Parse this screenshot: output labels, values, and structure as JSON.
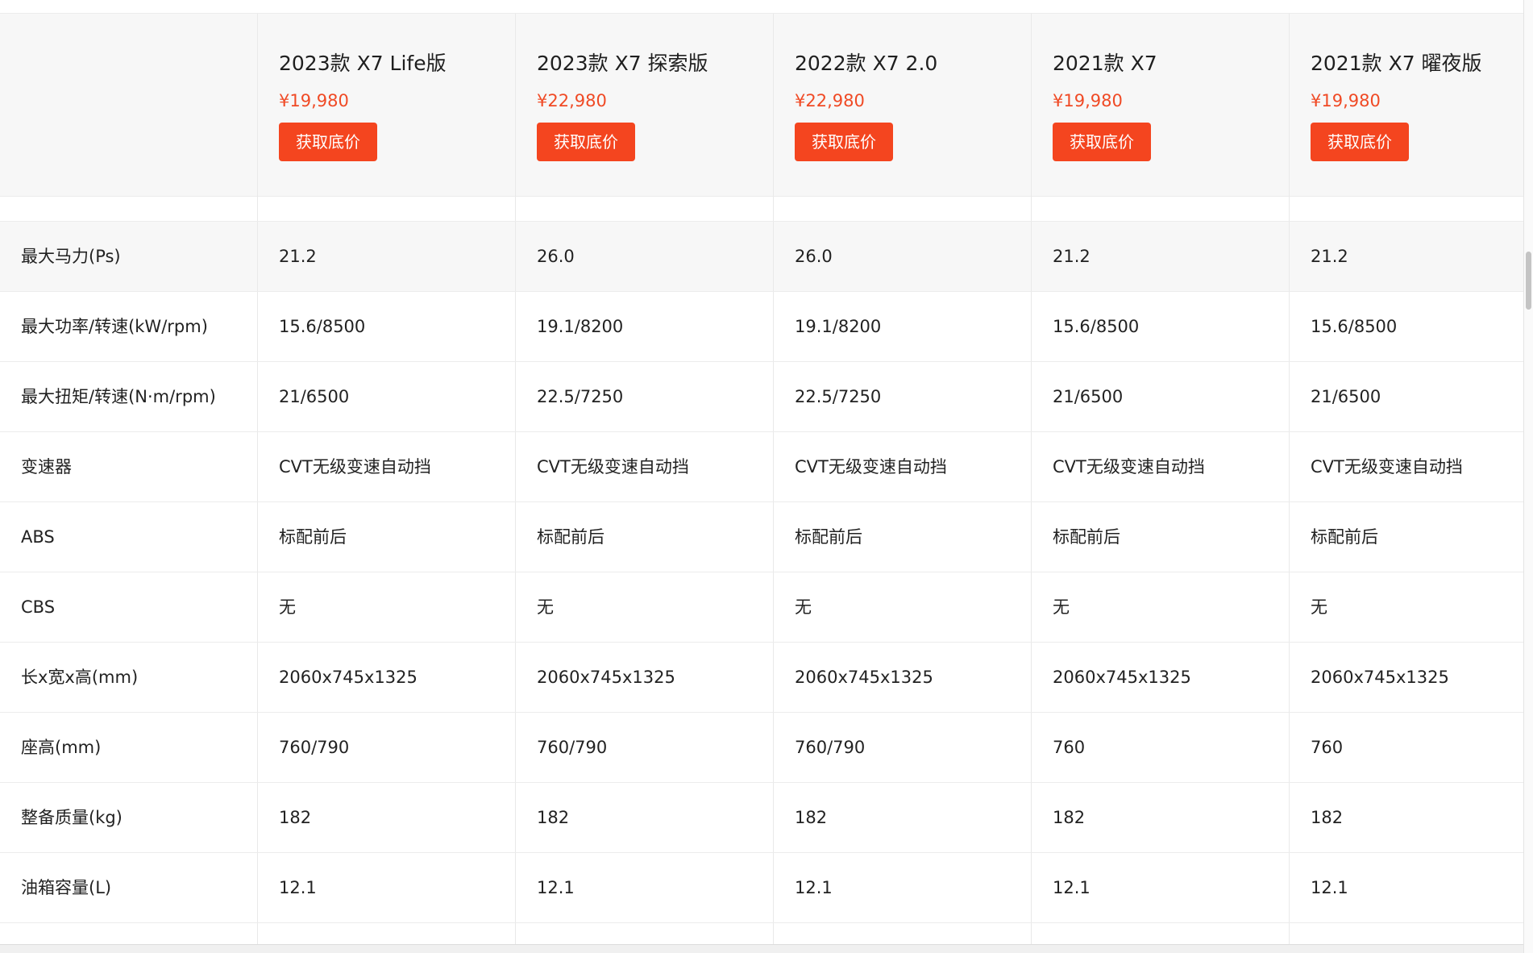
{
  "models": [
    {
      "title": "2023款 X7 Life版",
      "price": "¥19,980",
      "button": "获取底价"
    },
    {
      "title": "2023款 X7 探索版",
      "price": "¥22,980",
      "button": "获取底价"
    },
    {
      "title": "2022款 X7 2.0",
      "price": "¥22,980",
      "button": "获取底价"
    },
    {
      "title": "2021款 X7",
      "price": "¥19,980",
      "button": "获取底价"
    },
    {
      "title": "2021款 X7 曜夜版",
      "price": "¥19,980",
      "button": "获取底价"
    }
  ],
  "specs": [
    {
      "label": "最大马力(Ps)",
      "values": [
        "21.2",
        "26.0",
        "26.0",
        "21.2",
        "21.2"
      ]
    },
    {
      "label": "最大功率/转速(kW/rpm)",
      "values": [
        "15.6/8500",
        "19.1/8200",
        "19.1/8200",
        "15.6/8500",
        "15.6/8500"
      ]
    },
    {
      "label": "最大扭矩/转速(N·m/rpm)",
      "values": [
        "21/6500",
        "22.5/7250",
        "22.5/7250",
        "21/6500",
        "21/6500"
      ]
    },
    {
      "label": "变速器",
      "values": [
        "CVT无级变速自动挡",
        "CVT无级变速自动挡",
        "CVT无级变速自动挡",
        "CVT无级变速自动挡",
        "CVT无级变速自动挡"
      ]
    },
    {
      "label": "ABS",
      "values": [
        "标配前后",
        "标配前后",
        "标配前后",
        "标配前后",
        "标配前后"
      ]
    },
    {
      "label": "CBS",
      "values": [
        "无",
        "无",
        "无",
        "无",
        "无"
      ]
    },
    {
      "label": "长x宽x高(mm)",
      "values": [
        "2060x745x1325",
        "2060x745x1325",
        "2060x745x1325",
        "2060x745x1325",
        "2060x745x1325"
      ]
    },
    {
      "label": "座高(mm)",
      "values": [
        "760/790",
        "760/790",
        "760/790",
        "760",
        "760"
      ]
    },
    {
      "label": "整备质量(kg)",
      "values": [
        "182",
        "182",
        "182",
        "182",
        "182"
      ]
    },
    {
      "label": "油箱容量(L)",
      "values": [
        "12.1",
        "12.1",
        "12.1",
        "12.1",
        "12.1"
      ]
    }
  ],
  "colors": {
    "accent": "#f4451f",
    "price": "#f04a25",
    "header_bg": "#f7f7f7"
  }
}
